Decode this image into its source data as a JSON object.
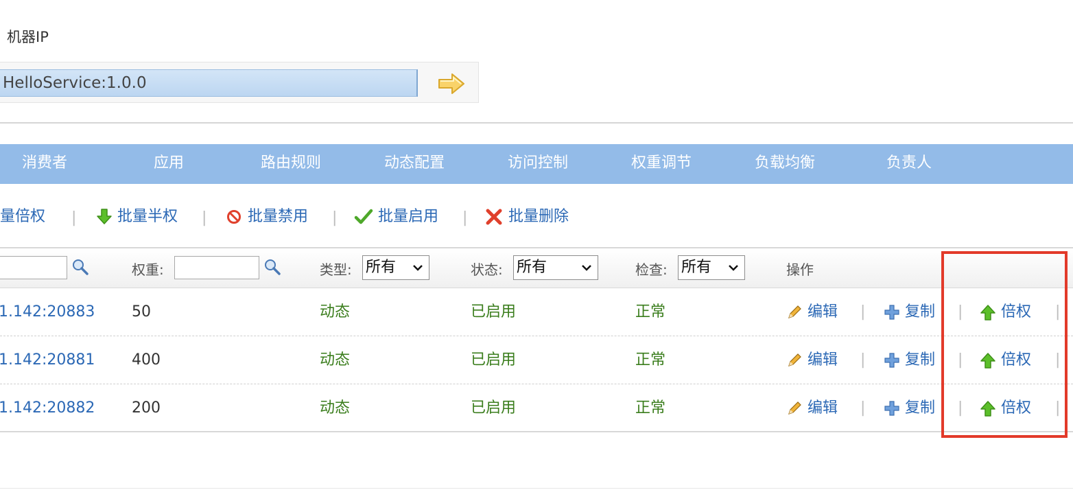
{
  "header": {
    "machine_ip_label": "机器IP"
  },
  "search": {
    "value": "HelloService:1.0.0"
  },
  "tabs": [
    {
      "label": "消费者"
    },
    {
      "label": "应用"
    },
    {
      "label": "路由规则"
    },
    {
      "label": "动态配置"
    },
    {
      "label": "访问控制"
    },
    {
      "label": "权重调节"
    },
    {
      "label": "负载均衡"
    },
    {
      "label": "负责人"
    }
  ],
  "batch_actions": {
    "double": "批量倍权",
    "half": "批量半权",
    "disable": "批量禁用",
    "enable": "批量启用",
    "delete": "批量删除",
    "separator": "|"
  },
  "filters": {
    "weight_label": "权重:",
    "type_label": "类型:",
    "type_value": "所有",
    "status_label": "状态:",
    "status_value": "所有",
    "check_label": "检查:",
    "check_value": "所有",
    "operation_label": "操作"
  },
  "rows": [
    {
      "address": "1.142:20883",
      "weight": "50",
      "type": "动态",
      "status": "已启用",
      "check": "正常",
      "edit": "编辑",
      "copy": "复制",
      "double": "倍权"
    },
    {
      "address": "1.142:20881",
      "weight": "400",
      "type": "动态",
      "status": "已启用",
      "check": "正常",
      "edit": "编辑",
      "copy": "复制",
      "double": "倍权"
    },
    {
      "address": "1.142:20882",
      "weight": "200",
      "type": "动态",
      "status": "已启用",
      "check": "正常",
      "edit": "编辑",
      "copy": "复制",
      "double": "倍权"
    }
  ],
  "separator": "|",
  "colors": {
    "tab_bar": "#93bbe8",
    "link": "#2b68b5",
    "status_green": "#3a7d1c",
    "highlight": "#e23a2a"
  },
  "icons": [
    "arrow-right-icon",
    "arrow-up-green-icon",
    "arrow-down-green-icon",
    "forbidden-icon",
    "check-icon",
    "delete-x-icon",
    "magnifier-icon",
    "pencil-icon",
    "plus-icon",
    "chevron-down-icon"
  ]
}
